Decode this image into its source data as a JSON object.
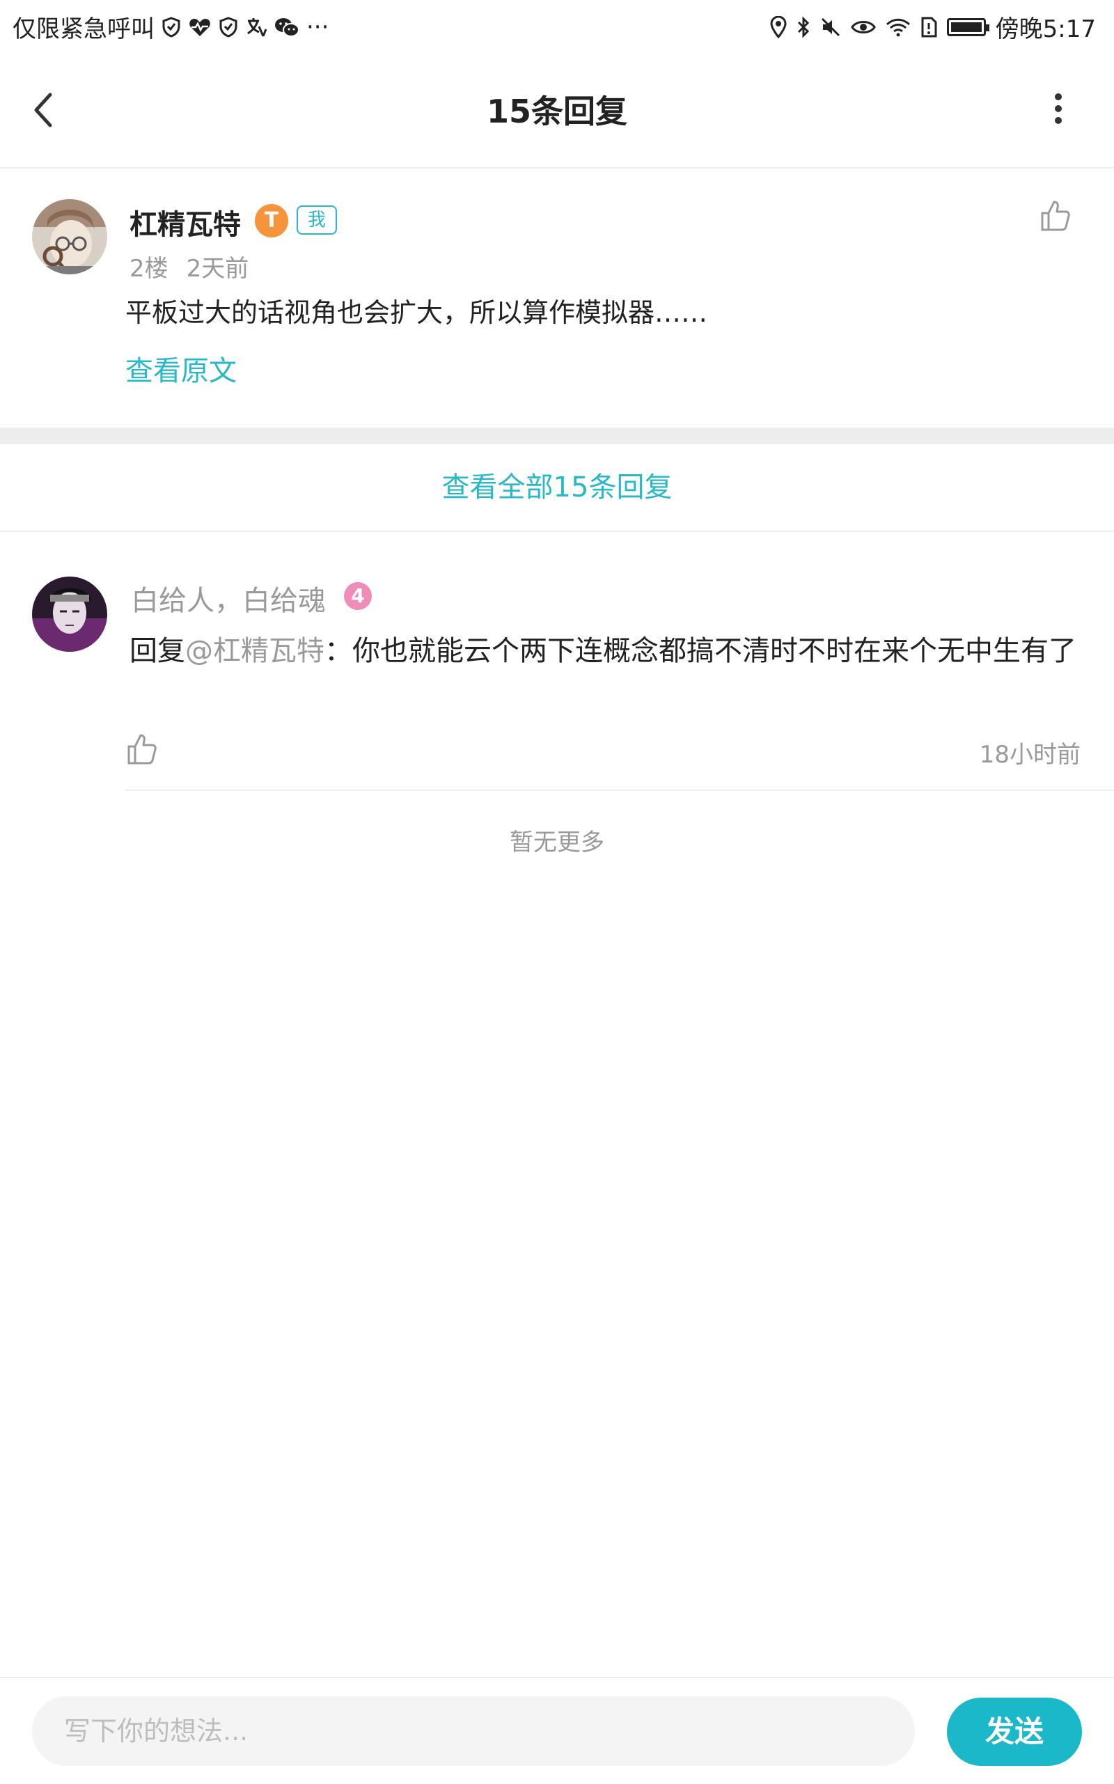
{
  "status_bar": {
    "left_text": "仅限紧急呼叫",
    "more": "···",
    "time": "傍晚5:17",
    "icons": [
      "shield-check-icon",
      "heartbeat-icon",
      "shield-check-icon",
      "translate-icon",
      "wechat-icon",
      "location-icon",
      "bluetooth-icon",
      "mute-icon",
      "eye-icon",
      "wifi-icon",
      "sim-alert-icon",
      "battery-icon"
    ]
  },
  "header": {
    "title": "15条回复"
  },
  "original_post": {
    "username": "杠精瓦特",
    "level_badge": "T",
    "me_badge": "我",
    "floor": "2楼",
    "time": "2天前",
    "content": "平板过大的话视角也会扩大，所以算作模拟器……",
    "view_original": "查看原文"
  },
  "view_all": "查看全部15条回复",
  "replies": [
    {
      "username": "白给人，白给魂",
      "level": "4",
      "reply_prefix": "回复",
      "mention": "@杠精瓦特",
      "content": "：你也就能云个两下连概念都搞不清时不时在来个无中生有了",
      "time": "18小时前"
    }
  ],
  "no_more": "暂无更多",
  "composer": {
    "placeholder": "写下你的想法...",
    "send_label": "发送"
  },
  "colors": {
    "accent": "#28b8c8",
    "send": "#1ab8c8",
    "level_orange": "#f5943a",
    "level_pink": "#f08cb8",
    "muted": "#9a9a9a"
  }
}
